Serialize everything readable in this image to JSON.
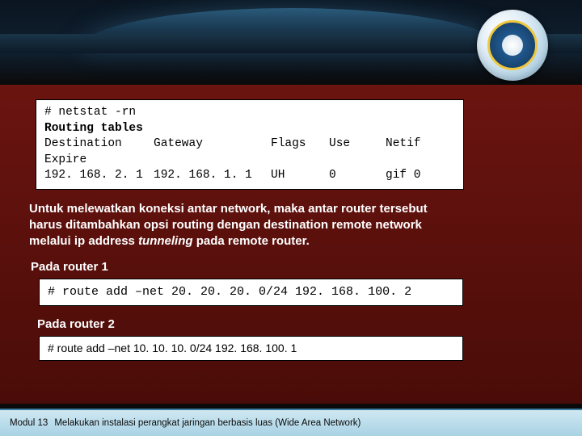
{
  "terminal1": {
    "line1": "# netstat -rn",
    "line2": "Routing tables",
    "headers": {
      "dest": "Destination",
      "gw": "Gateway",
      "flags": "Flags",
      "use": "Use",
      "netif": "Netif"
    },
    "line_expire": "Expire",
    "row": {
      "dest": "192. 168. 2. 1",
      "gw": "192. 168. 1. 1",
      "flags": "UH",
      "use": "0",
      "netif": "gif 0"
    }
  },
  "para": {
    "l1": "Untuk melewatkan koneksi antar network, maka antar router tersebut",
    "l2": "harus ditambahkan opsi routing dengan destination remote network",
    "l3a": "melalui ip address ",
    "l3b": "tunneling",
    "l3c": " pada remote router."
  },
  "label_router1": "Pada router 1",
  "terminal2": "# route add –net 20. 20. 20. 0/24 192. 168. 100. 2",
  "label_router2": "Pada router 2",
  "terminal3": "# route add –net 10. 10. 10. 0/24 192. 168. 100. 1",
  "footer": {
    "module": "Modul 13",
    "title": "Melakukan instalasi perangkat jaringan berbasis luas (Wide Area Network)"
  }
}
